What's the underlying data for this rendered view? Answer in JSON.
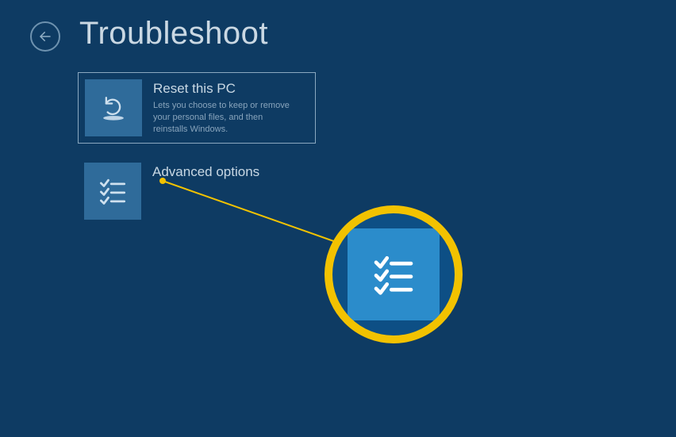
{
  "header": {
    "title": "Troubleshoot"
  },
  "tiles": {
    "reset": {
      "title": "Reset this PC",
      "desc": "Lets you choose to keep or remove your personal files, and then reinstalls Windows."
    },
    "advanced": {
      "title": "Advanced options"
    }
  },
  "colors": {
    "accent": "#f2c200",
    "bg": "#0e3b63",
    "tile_icon_bg": "#2f6b9a",
    "callout_icon_bg": "#2b8ccb"
  }
}
